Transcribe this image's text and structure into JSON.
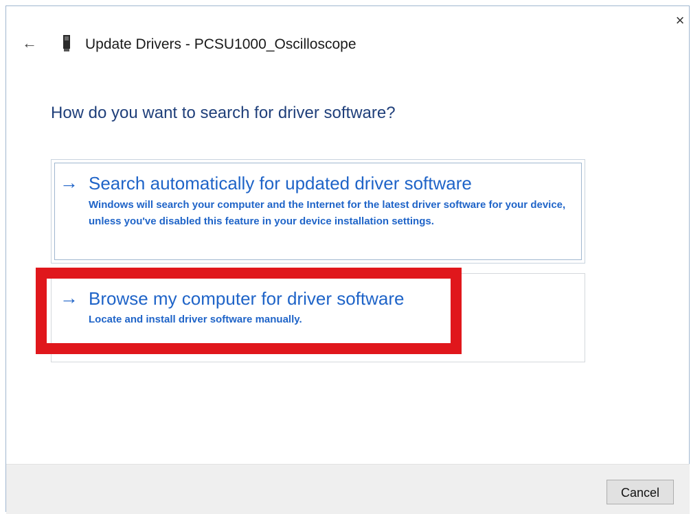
{
  "window": {
    "title": "Update Drivers - PCSU1000_Oscilloscope",
    "close_glyph": "×",
    "back_glyph": "←"
  },
  "heading": "How do you want to search for driver software?",
  "options": [
    {
      "arrow": "→",
      "title": "Search automatically for updated driver software",
      "description": "Windows will search your computer and the Internet for the latest driver software for your device, unless you've disabled this feature in your device installation settings."
    },
    {
      "arrow": "→",
      "title": "Browse my computer for driver software",
      "description": "Locate and install driver software manually.",
      "highlighted": true
    }
  ],
  "footer": {
    "cancel_label": "Cancel"
  },
  "colors": {
    "link_blue": "#1f64c8",
    "heading_blue": "#1f3f7a",
    "highlight_red": "#e0171c",
    "footer_bg": "#efefef"
  },
  "icons": {
    "back": "back-arrow-icon",
    "device": "device-icon",
    "close": "close-icon",
    "option_arrow": "right-arrow-icon"
  }
}
